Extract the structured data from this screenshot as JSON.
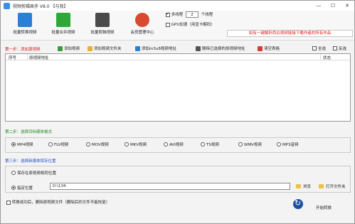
{
  "window": {
    "title": "视频剪辑高手 V8.0 【与我】",
    "min": "—",
    "max": "☐",
    "close": "✕"
  },
  "toolbar": [
    {
      "label": "批量转换视频",
      "color": "#2a7fd8"
    },
    {
      "label": "批量合并视频",
      "color": "#2fa83a"
    },
    {
      "label": "批量剪辑视频",
      "color": "#4a4a4a"
    },
    {
      "label": "会员管理中心",
      "color": "#d84a30"
    }
  ],
  "options": {
    "multithread_label": "多线程",
    "multithread_checked": true,
    "threads": "2",
    "threads_unit": "个线程",
    "gpu_label": "GPU加速（用显卡解码）",
    "gpu_checked": false
  },
  "promo": "如有一键解析西瓜视频链接下载作者的所有作品",
  "step1": {
    "label": "第一步：添加源视频",
    "actions": [
      "添加视频",
      "添加视频文件夹",
      "添加m3u8视频地址",
      "删除已选择的原视频地址",
      "清空表格"
    ],
    "select_all": "全选",
    "invert": "反选",
    "columns": [
      "序号",
      "原视频地址",
      "状态"
    ]
  },
  "step2": {
    "label": "第二步：选择目标媒体格式",
    "formats": [
      "MP4视频",
      "FLV视频",
      "MOV视频",
      "MKV视频",
      "AVI视频",
      "TS视频",
      "WMV视频",
      "MP3音频"
    ],
    "selected": 0
  },
  "step3": {
    "label": "第三步：选择新媒体保存位置",
    "same_dir": "保存在原视频相同位置",
    "custom_dir": "指定位置",
    "path": "D:\\134",
    "browse": "浏览",
    "open_folder": "打开文件夹"
  },
  "footer": {
    "delete_source_label": "转换成功后，删除原视频文件（删除后的文件不能恢复）",
    "start": "开始转换"
  },
  "colors": {
    "step1": "#d11a1a",
    "step2": "#1a8a1a",
    "step3": "#2050c8",
    "promo": "#e02020"
  }
}
